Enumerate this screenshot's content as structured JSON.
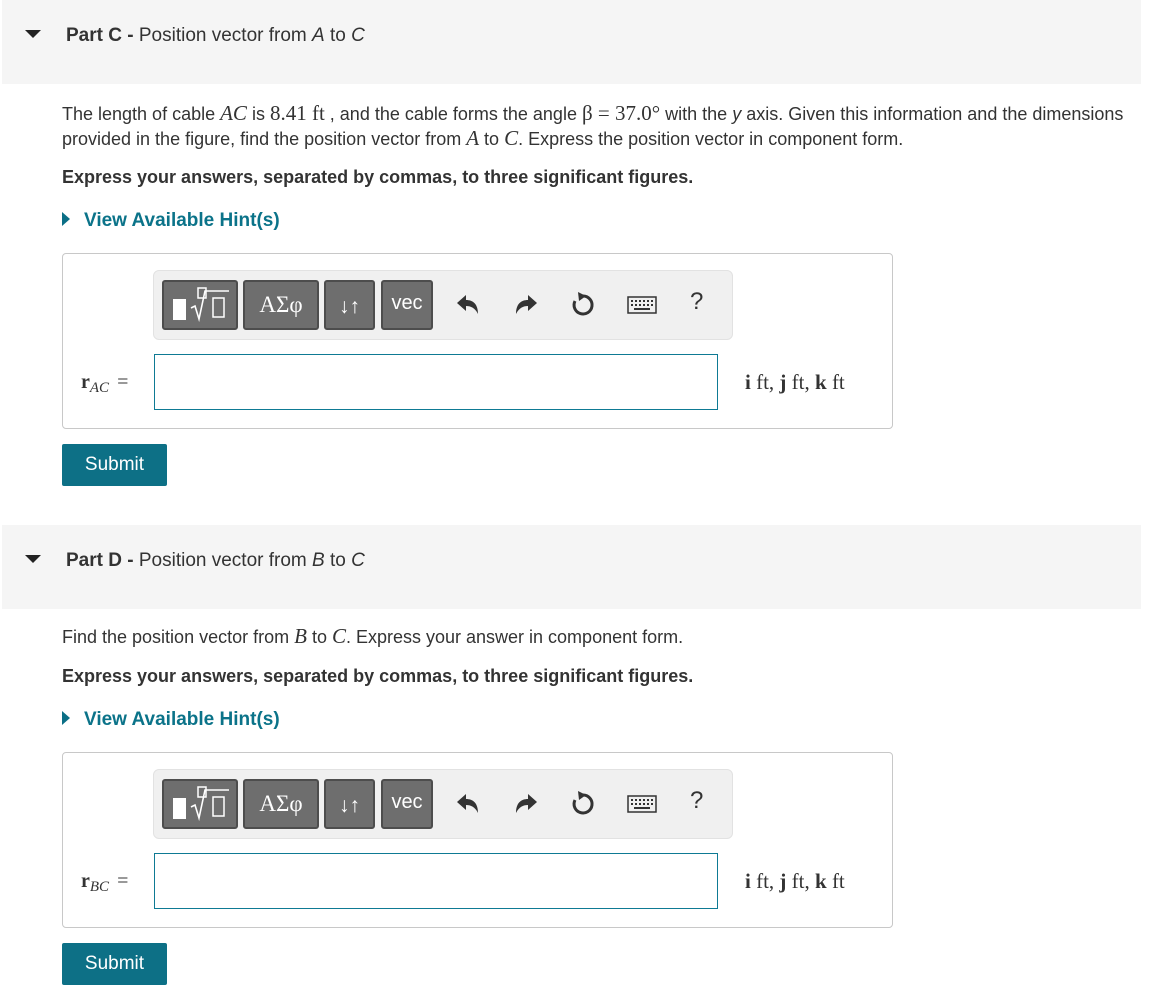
{
  "partC": {
    "label": "Part C -",
    "title_pre": "Position vector from ",
    "title_a": "A",
    "title_mid": " to ",
    "title_b": "C",
    "p1": "The length of cable ",
    "p1_ac": "AC",
    "p1_is": " is ",
    "p1_len": "8.41 ft",
    "p1_b": " , and the cable forms the angle ",
    "p1_beta": "β = 37.0°",
    "p1_c": " with the ",
    "p1_y": "y",
    "p1_d": " axis. Given this information and the dimensions provided in the figure, find the position vector from ",
    "p1_A": "A",
    "p1_to": " to ",
    "p1_C": "C",
    "p1_e": ". Express the position vector in component form.",
    "instruction": "Express your answers, separated by commas, to three significant figures.",
    "hint": "View Available Hint(s)",
    "var_r": "r",
    "var_sub": "AC",
    "var_eq": "=",
    "input_value": "",
    "submit": "Submit"
  },
  "partD": {
    "label": "Part D -",
    "title_pre": "Position vector from ",
    "title_a": "B",
    "title_mid": " to ",
    "title_b": "C",
    "p1": "Find the position vector from ",
    "p1_B": "B",
    "p1_to": " to ",
    "p1_C": "C",
    "p1_e": ". Express your answer in component form.",
    "instruction": "Express your answers, separated by commas, to three significant figures.",
    "hint": "View Available Hint(s)",
    "var_r": "r",
    "var_sub": "BC",
    "var_eq": "=",
    "input_value": "",
    "submit": "Submit"
  },
  "toolbar": {
    "templates_icon": "fraction-root-template-icon",
    "greek_label": "ΑΣφ",
    "arrows_label": "↓↑",
    "vec_label": "vec",
    "undo_icon": "undo-icon",
    "redo_icon": "redo-icon",
    "reset_icon": "reset-icon",
    "keyboard_icon": "keyboard-icon",
    "help_label": "?"
  },
  "units": {
    "i": "i",
    "ft": " ft, ",
    "j": "j",
    "k": "k",
    "ft_end": " ft"
  },
  "colors": {
    "accent": "#0d7086",
    "link": "#0b7389",
    "header_bg": "#f5f5f5",
    "toolbar_button": "#6e6e6e"
  }
}
